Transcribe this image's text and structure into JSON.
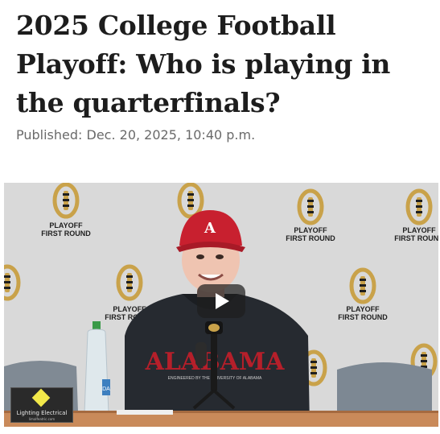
{
  "article": {
    "headline": "2025 College Football Playoff: Who is playing in the quarterfinals?",
    "published": "Published: Dec. 20, 2025, 10:40 p.m."
  },
  "video": {
    "backdrop_text_line1": "PLAYOFF",
    "backdrop_text_line2": "FIRST ROUND",
    "cap_logo": "A",
    "hoodie_text": "ALABAMA",
    "hoodie_subtext": "ENGINEERED BY THE UNIVERSITY OF ALABAMA",
    "bottle_label": "DA",
    "sponsor_name": "Lighting Electrical",
    "sponsor_url": "limalfeatric.com",
    "play_icon": "play-icon",
    "colors": {
      "backdrop": "#d9d9d9",
      "logo_gold": "#c9a24a",
      "hoodie": "#262a30",
      "alabama_red": "#b51f2a",
      "cap": "#c8202f",
      "table": "#c98a5a"
    }
  }
}
